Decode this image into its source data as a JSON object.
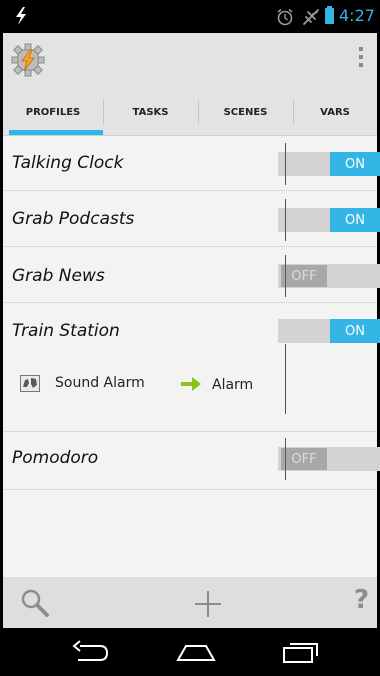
{
  "status_bar": {
    "time": "4:27",
    "icons": [
      "charging-bolt-icon",
      "alarm-icon",
      "airplane-mode-icon",
      "battery-icon"
    ]
  },
  "action_bar": {
    "app_icon": "tasker-gear-bolt-icon",
    "overflow_icon": "overflow-menu-icon"
  },
  "tabs": [
    {
      "label": "PROFILES",
      "selected": true
    },
    {
      "label": "TASKS",
      "selected": false
    },
    {
      "label": "SCENES",
      "selected": false
    },
    {
      "label": "VARS",
      "selected": false
    }
  ],
  "profiles": [
    {
      "name": "Talking Clock",
      "state": "ON"
    },
    {
      "name": "Grab Podcasts",
      "state": "ON"
    },
    {
      "name": "Grab News",
      "state": "OFF"
    },
    {
      "name": "Train Station",
      "state": "ON",
      "context": {
        "label": "Sound Alarm",
        "icon": "map-icon",
        "arrow": "arrow-right-icon",
        "task": "Alarm"
      }
    },
    {
      "name": "Pomodoro",
      "state": "OFF"
    }
  ],
  "bottom_bar": {
    "search_icon": "search-icon",
    "add_icon": "plus-icon",
    "help_label": "?"
  },
  "nav_bar": {
    "icons": [
      "back-icon",
      "home-icon",
      "recents-icon"
    ]
  },
  "colors": {
    "accent": "#33b5e5",
    "arrow": "#8ec21a",
    "toggle_off": "#a8a8a8"
  }
}
